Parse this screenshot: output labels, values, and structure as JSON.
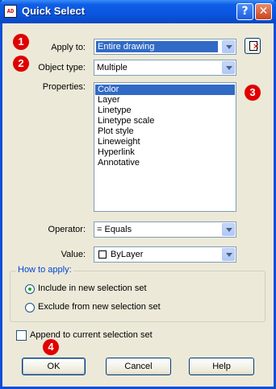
{
  "window": {
    "title": "Quick Select",
    "icon_text": "AD",
    "help_glyph": "?",
    "close_glyph": "✕"
  },
  "apply_to": {
    "label": "Apply to:",
    "value": "Entire drawing"
  },
  "object_type": {
    "label": "Object type:",
    "value": "Multiple"
  },
  "properties": {
    "label": "Properties:",
    "items": [
      "Color",
      "Layer",
      "Linetype",
      "Linetype scale",
      "Plot style",
      "Lineweight",
      "Hyperlink",
      "Annotative"
    ],
    "selected": "Color"
  },
  "operator": {
    "label": "Operator:",
    "value": "= Equals"
  },
  "value_field": {
    "label": "Value:",
    "value": "ByLayer"
  },
  "how_to_apply": {
    "title": "How to apply:",
    "options": [
      {
        "label": "Include in new selection set",
        "checked": true
      },
      {
        "label": "Exclude from new selection set",
        "checked": false
      }
    ]
  },
  "append": {
    "label": "Append to current selection set",
    "checked": false
  },
  "buttons": {
    "ok": "OK",
    "cancel": "Cancel",
    "help": "Help"
  },
  "callouts": [
    "1",
    "2",
    "3",
    "4"
  ],
  "colors": {
    "title_bar": "#0a55df",
    "selection": "#316ac5",
    "callout": "#e00000",
    "group_title": "#0046d5"
  }
}
